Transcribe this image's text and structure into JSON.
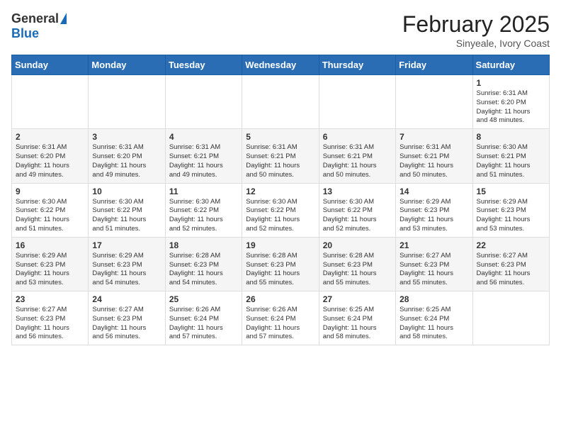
{
  "logo": {
    "general": "General",
    "blue": "Blue"
  },
  "title": "February 2025",
  "subtitle": "Sinyeale, Ivory Coast",
  "days_header": [
    "Sunday",
    "Monday",
    "Tuesday",
    "Wednesday",
    "Thursday",
    "Friday",
    "Saturday"
  ],
  "weeks": [
    [
      {
        "day": "",
        "info": ""
      },
      {
        "day": "",
        "info": ""
      },
      {
        "day": "",
        "info": ""
      },
      {
        "day": "",
        "info": ""
      },
      {
        "day": "",
        "info": ""
      },
      {
        "day": "",
        "info": ""
      },
      {
        "day": "1",
        "info": "Sunrise: 6:31 AM\nSunset: 6:20 PM\nDaylight: 11 hours\nand 48 minutes."
      }
    ],
    [
      {
        "day": "2",
        "info": "Sunrise: 6:31 AM\nSunset: 6:20 PM\nDaylight: 11 hours\nand 49 minutes."
      },
      {
        "day": "3",
        "info": "Sunrise: 6:31 AM\nSunset: 6:20 PM\nDaylight: 11 hours\nand 49 minutes."
      },
      {
        "day": "4",
        "info": "Sunrise: 6:31 AM\nSunset: 6:21 PM\nDaylight: 11 hours\nand 49 minutes."
      },
      {
        "day": "5",
        "info": "Sunrise: 6:31 AM\nSunset: 6:21 PM\nDaylight: 11 hours\nand 50 minutes."
      },
      {
        "day": "6",
        "info": "Sunrise: 6:31 AM\nSunset: 6:21 PM\nDaylight: 11 hours\nand 50 minutes."
      },
      {
        "day": "7",
        "info": "Sunrise: 6:31 AM\nSunset: 6:21 PM\nDaylight: 11 hours\nand 50 minutes."
      },
      {
        "day": "8",
        "info": "Sunrise: 6:30 AM\nSunset: 6:21 PM\nDaylight: 11 hours\nand 51 minutes."
      }
    ],
    [
      {
        "day": "9",
        "info": "Sunrise: 6:30 AM\nSunset: 6:22 PM\nDaylight: 11 hours\nand 51 minutes."
      },
      {
        "day": "10",
        "info": "Sunrise: 6:30 AM\nSunset: 6:22 PM\nDaylight: 11 hours\nand 51 minutes."
      },
      {
        "day": "11",
        "info": "Sunrise: 6:30 AM\nSunset: 6:22 PM\nDaylight: 11 hours\nand 52 minutes."
      },
      {
        "day": "12",
        "info": "Sunrise: 6:30 AM\nSunset: 6:22 PM\nDaylight: 11 hours\nand 52 minutes."
      },
      {
        "day": "13",
        "info": "Sunrise: 6:30 AM\nSunset: 6:22 PM\nDaylight: 11 hours\nand 52 minutes."
      },
      {
        "day": "14",
        "info": "Sunrise: 6:29 AM\nSunset: 6:23 PM\nDaylight: 11 hours\nand 53 minutes."
      },
      {
        "day": "15",
        "info": "Sunrise: 6:29 AM\nSunset: 6:23 PM\nDaylight: 11 hours\nand 53 minutes."
      }
    ],
    [
      {
        "day": "16",
        "info": "Sunrise: 6:29 AM\nSunset: 6:23 PM\nDaylight: 11 hours\nand 53 minutes."
      },
      {
        "day": "17",
        "info": "Sunrise: 6:29 AM\nSunset: 6:23 PM\nDaylight: 11 hours\nand 54 minutes."
      },
      {
        "day": "18",
        "info": "Sunrise: 6:28 AM\nSunset: 6:23 PM\nDaylight: 11 hours\nand 54 minutes."
      },
      {
        "day": "19",
        "info": "Sunrise: 6:28 AM\nSunset: 6:23 PM\nDaylight: 11 hours\nand 55 minutes."
      },
      {
        "day": "20",
        "info": "Sunrise: 6:28 AM\nSunset: 6:23 PM\nDaylight: 11 hours\nand 55 minutes."
      },
      {
        "day": "21",
        "info": "Sunrise: 6:27 AM\nSunset: 6:23 PM\nDaylight: 11 hours\nand 55 minutes."
      },
      {
        "day": "22",
        "info": "Sunrise: 6:27 AM\nSunset: 6:23 PM\nDaylight: 11 hours\nand 56 minutes."
      }
    ],
    [
      {
        "day": "23",
        "info": "Sunrise: 6:27 AM\nSunset: 6:23 PM\nDaylight: 11 hours\nand 56 minutes."
      },
      {
        "day": "24",
        "info": "Sunrise: 6:27 AM\nSunset: 6:23 PM\nDaylight: 11 hours\nand 56 minutes."
      },
      {
        "day": "25",
        "info": "Sunrise: 6:26 AM\nSunset: 6:24 PM\nDaylight: 11 hours\nand 57 minutes."
      },
      {
        "day": "26",
        "info": "Sunrise: 6:26 AM\nSunset: 6:24 PM\nDaylight: 11 hours\nand 57 minutes."
      },
      {
        "day": "27",
        "info": "Sunrise: 6:25 AM\nSunset: 6:24 PM\nDaylight: 11 hours\nand 58 minutes."
      },
      {
        "day": "28",
        "info": "Sunrise: 6:25 AM\nSunset: 6:24 PM\nDaylight: 11 hours\nand 58 minutes."
      },
      {
        "day": "",
        "info": ""
      }
    ]
  ]
}
